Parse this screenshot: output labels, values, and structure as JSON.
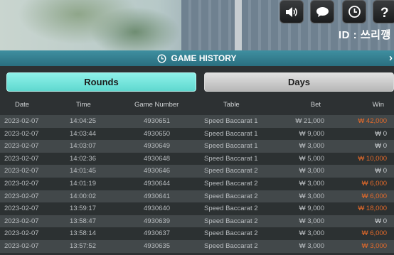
{
  "topbar": {
    "user_id": "ID : 쓰리깽",
    "buttons": [
      {
        "name": "sound-button",
        "icon": "speaker-icon"
      },
      {
        "name": "chat-button",
        "icon": "chat-bubble-icon"
      },
      {
        "name": "history-button",
        "icon": "history-clock-icon"
      },
      {
        "name": "help-button",
        "icon": "question-icon"
      }
    ]
  },
  "panel": {
    "title": "GAME HISTORY",
    "tabs": {
      "rounds": "Rounds",
      "days": "Days"
    },
    "columns": [
      "Date",
      "Time",
      "Game Number",
      "Table",
      "Bet",
      "Win"
    ],
    "rows": [
      {
        "date": "2023-02-07",
        "time": "14:04:25",
        "game": "4930651",
        "table": "Speed Baccarat 1",
        "bet": "₩ 21,000",
        "win": "₩ 42,000",
        "won": true
      },
      {
        "date": "2023-02-07",
        "time": "14:03:44",
        "game": "4930650",
        "table": "Speed Baccarat 1",
        "bet": "₩ 9,000",
        "win": "₩ 0",
        "won": false
      },
      {
        "date": "2023-02-07",
        "time": "14:03:07",
        "game": "4930649",
        "table": "Speed Baccarat 1",
        "bet": "₩ 3,000",
        "win": "₩ 0",
        "won": false
      },
      {
        "date": "2023-02-07",
        "time": "14:02:36",
        "game": "4930648",
        "table": "Speed Baccarat 1",
        "bet": "₩ 5,000",
        "win": "₩ 10,000",
        "won": true
      },
      {
        "date": "2023-02-07",
        "time": "14:01:45",
        "game": "4930646",
        "table": "Speed Baccarat 2",
        "bet": "₩ 3,000",
        "win": "₩ 0",
        "won": false
      },
      {
        "date": "2023-02-07",
        "time": "14:01:19",
        "game": "4930644",
        "table": "Speed Baccarat 2",
        "bet": "₩ 3,000",
        "win": "₩ 6,000",
        "won": true
      },
      {
        "date": "2023-02-07",
        "time": "14:00:02",
        "game": "4930641",
        "table": "Speed Baccarat 2",
        "bet": "₩ 3,000",
        "win": "₩ 6,000",
        "won": true
      },
      {
        "date": "2023-02-07",
        "time": "13:59:17",
        "game": "4930640",
        "table": "Speed Baccarat 2",
        "bet": "₩ 9,000",
        "win": "₩ 18,000",
        "won": true
      },
      {
        "date": "2023-02-07",
        "time": "13:58:47",
        "game": "4930639",
        "table": "Speed Baccarat 2",
        "bet": "₩ 3,000",
        "win": "₩ 0",
        "won": false
      },
      {
        "date": "2023-02-07",
        "time": "13:58:14",
        "game": "4930637",
        "table": "Speed Baccarat 2",
        "bet": "₩ 3,000",
        "win": "₩ 6,000",
        "won": true
      },
      {
        "date": "2023-02-07",
        "time": "13:57:52",
        "game": "4930635",
        "table": "Speed Baccarat 2",
        "bet": "₩ 3,000",
        "win": "₩ 3,000",
        "won": true
      }
    ]
  },
  "colors": {
    "accent_tab": "#6fe3da",
    "header_bar": "#3a8596",
    "win": "#e36a2a"
  }
}
